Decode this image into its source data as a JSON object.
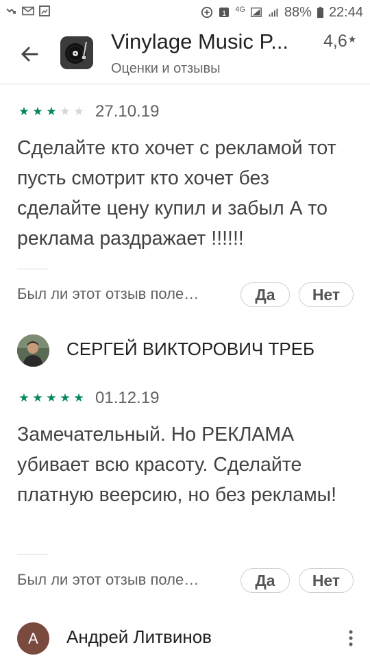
{
  "status_bar": {
    "battery": "88%",
    "time": "22:44",
    "network": "4G",
    "icons": [
      "missed-call-icon",
      "mail-icon",
      "gallery-icon",
      "add-circle-icon",
      "sim-icon",
      "signal-icon",
      "battery-icon"
    ]
  },
  "header": {
    "title": "Vinylage Music P...",
    "subtitle": "Оценки и отзывы",
    "rating": "4,6",
    "rating_star": "★"
  },
  "reviews": [
    {
      "stars": 3,
      "date": "27.10.19",
      "text": "Сделайте кто хочет с рекламой тот пусть смотрит кто хочет без сделайте цену купил и забыл А то реклама раздражает !!!!!!",
      "helpful_question": "Был ли этот отзыв поле…",
      "yes_label": "Да",
      "no_label": "Нет"
    },
    {
      "author": "СЕРГЕЙ ВИКТОРОВИЧ ТРЕБ",
      "stars": 5,
      "date": "01.12.19",
      "text": "Замечательный. Но РЕКЛАМА убивает всю красоту. Сделайте платную веерсию, но без рекламы!",
      "helpful_question": "Был ли этот отзыв поле…",
      "yes_label": "Да",
      "no_label": "Нет"
    },
    {
      "author": "Андрей Литвинов",
      "avatar_letter": "А"
    }
  ],
  "colors": {
    "star_on": "#01875f",
    "star_off": "#d6d6d6",
    "avatar_letter_bg": "#7a4a3f"
  }
}
